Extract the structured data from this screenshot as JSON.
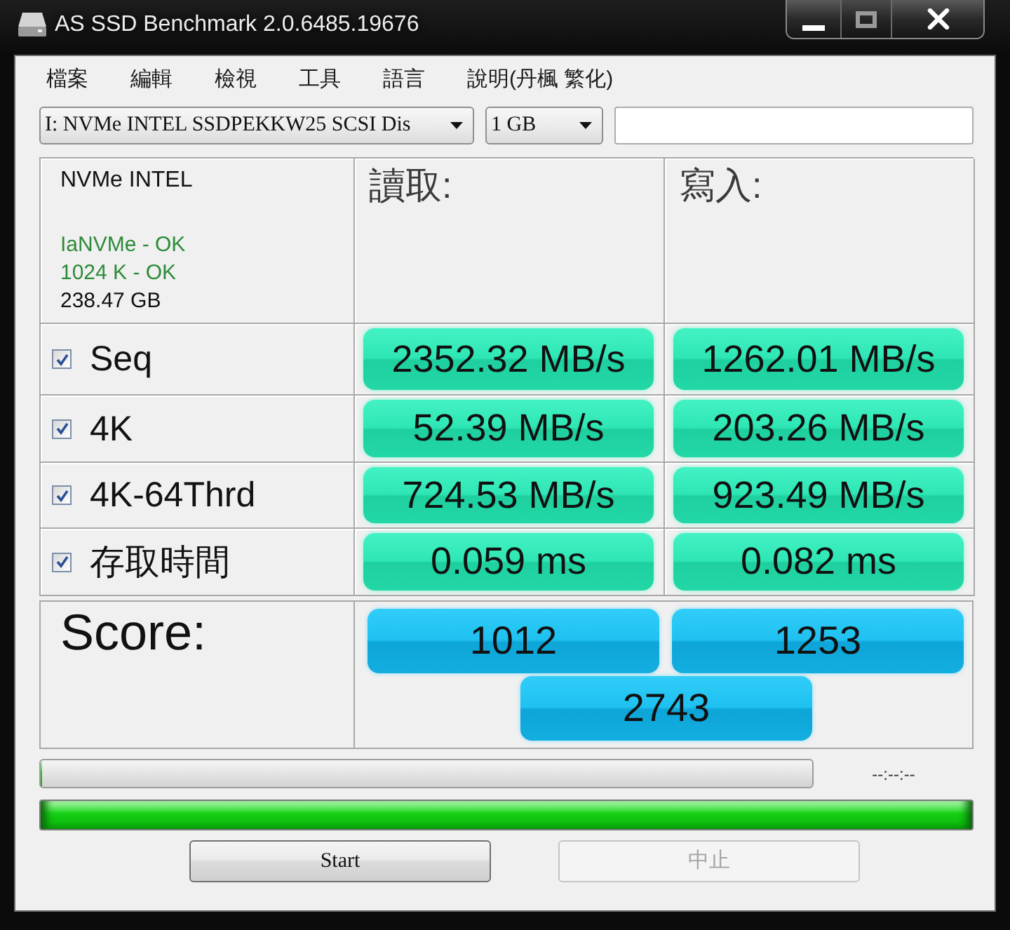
{
  "window": {
    "title": "AS SSD Benchmark 2.0.6485.19676"
  },
  "menu": [
    "檔案",
    "編輯",
    "檢視",
    "工具",
    "語言",
    "說明(丹楓 繁化)"
  ],
  "drive_select": {
    "value": "I: NVMe INTEL SSDPEKKW25 SCSI Dis"
  },
  "size_select": {
    "value": "1 GB"
  },
  "drive_info": {
    "name": "NVMe INTEL",
    "status": [
      {
        "text": "IaNVMe - OK",
        "ok": true
      },
      {
        "text": "1024 K - OK",
        "ok": true
      }
    ],
    "capacity": "238.47 GB"
  },
  "columns": [
    "讀取:",
    "寫入:"
  ],
  "tests": [
    {
      "label": "Seq",
      "checked": true,
      "read": "2352.32 MB/s",
      "write": "1262.01 MB/s"
    },
    {
      "label": "4K",
      "checked": true,
      "read": "52.39 MB/s",
      "write": "203.26 MB/s"
    },
    {
      "label": "4K-64Thrd",
      "checked": true,
      "read": "724.53 MB/s",
      "write": "923.49 MB/s"
    },
    {
      "label": "存取時間",
      "checked": true,
      "read": "0.059 ms",
      "write": "0.082 ms"
    }
  ],
  "score": {
    "label": "Score:",
    "read": "1012",
    "write": "1253",
    "total": "2743"
  },
  "progress": {
    "level": 0
  },
  "time": "--:--:--",
  "total_progress": {
    "level": 1
  },
  "buttons": [
    {
      "label": "Start",
      "disabled": false
    },
    {
      "label": "中止",
      "disabled": true
    }
  ]
}
